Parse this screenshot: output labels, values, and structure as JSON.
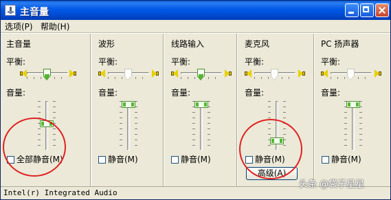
{
  "window": {
    "title": "主音量"
  },
  "menu": [
    {
      "label": "选项(P)"
    },
    {
      "label": "帮助(H)"
    }
  ],
  "columns": [
    {
      "title": "主音量",
      "balance_label": "平衡:",
      "volume_label": "音量:",
      "mute_label": "全部静音(M)",
      "muted": false,
      "volume_level": 0.55,
      "balance": 0.5
    },
    {
      "title": "波形",
      "balance_label": "平衡:",
      "volume_label": "音量:",
      "mute_label": "静音(M)",
      "muted": false,
      "volume_level": 1.0,
      "balance": 0.5
    },
    {
      "title": "线路输入",
      "balance_label": "平衡:",
      "volume_label": "音量:",
      "mute_label": "静音(M)",
      "muted": false,
      "volume_level": 1.0,
      "balance": 0.5
    },
    {
      "title": "麦克风",
      "balance_label": "平衡:",
      "volume_label": "音量:",
      "mute_label": "静音(M)",
      "muted": false,
      "volume_level": 0.15,
      "balance": 0.5
    },
    {
      "title": "PC 扬声器",
      "balance_label": "平衡:",
      "volume_label": "音量:",
      "mute_label": "静音(M)",
      "muted": false,
      "volume_level": 1.0,
      "balance": 0.5
    }
  ],
  "advanced_button": "高级(A)",
  "status_bar": "Intel(r) Integrated Audio",
  "watermark": "头条 @袋子星星",
  "colors": {
    "titlebar": "#0058e6",
    "annotation_circle": "#e02020",
    "thumb_green": "#51b92f"
  }
}
